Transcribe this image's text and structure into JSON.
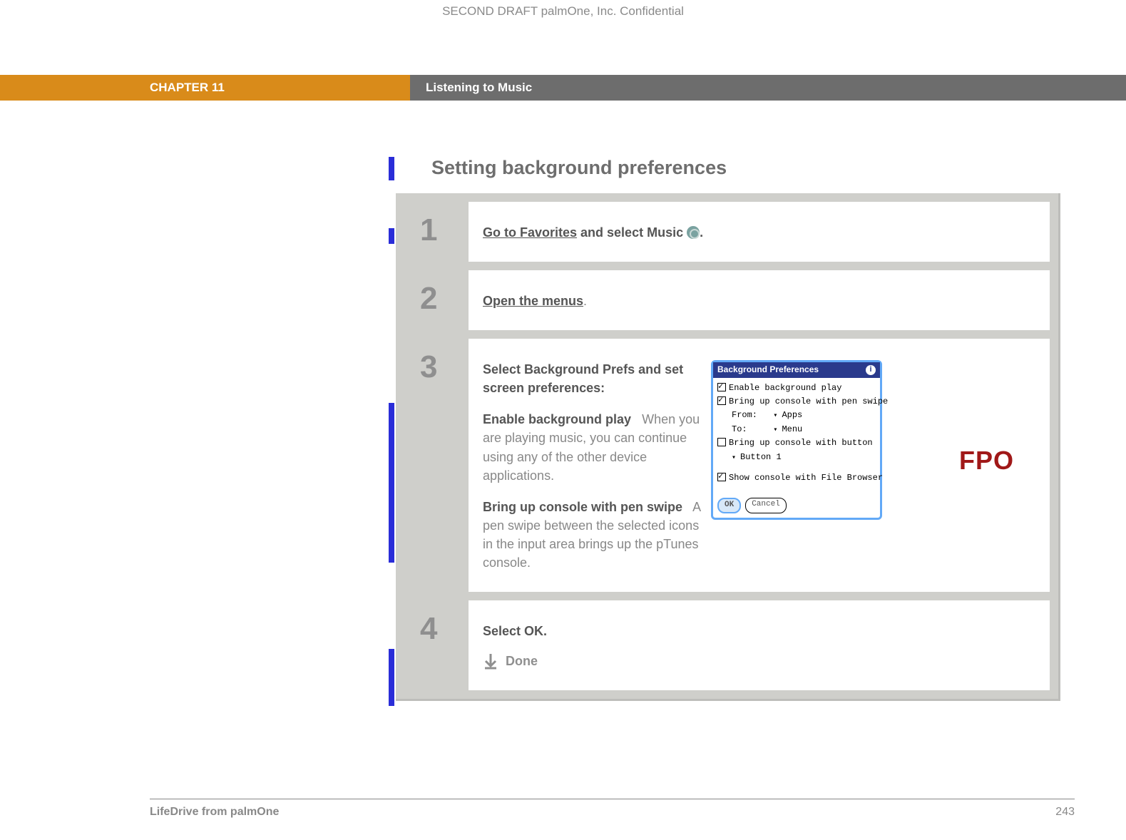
{
  "confidential": "SECOND DRAFT palmOne, Inc.  Confidential",
  "header": {
    "chapter": "CHAPTER 11",
    "title": "Listening to Music"
  },
  "section_title": "Setting background preferences",
  "steps": [
    {
      "num": "1",
      "link": "Go to Favorites",
      "after_link": " and select Music ",
      "period": "."
    },
    {
      "num": "2",
      "link": "Open the menus",
      "period": "."
    },
    {
      "num": "3",
      "intro": "Select Background Prefs and set screen preferences:",
      "opt1_title": "Enable background play",
      "opt1_body": "When you are playing music, you can continue using any of the other device applications.",
      "opt2_title": "Bring up console with pen swipe",
      "opt2_body": "A pen swipe between the selected icons in the input area brings up the pTunes console.",
      "fpo": "FPO",
      "dialog": {
        "title": "Background Preferences",
        "opt_enable": "Enable background play",
        "opt_pen": "Bring up console with pen swipe",
        "from_label": "From:",
        "from_value": "Apps",
        "to_label": "To:",
        "to_value": "Menu",
        "opt_button": "Bring up console with button",
        "button_value": "Button 1",
        "opt_fb": "Show console with File Browser",
        "ok": "OK",
        "cancel": "Cancel"
      }
    },
    {
      "num": "4",
      "text": "Select OK.",
      "done": "Done"
    }
  ],
  "footer": {
    "left": "LifeDrive from palmOne",
    "right": "243"
  }
}
